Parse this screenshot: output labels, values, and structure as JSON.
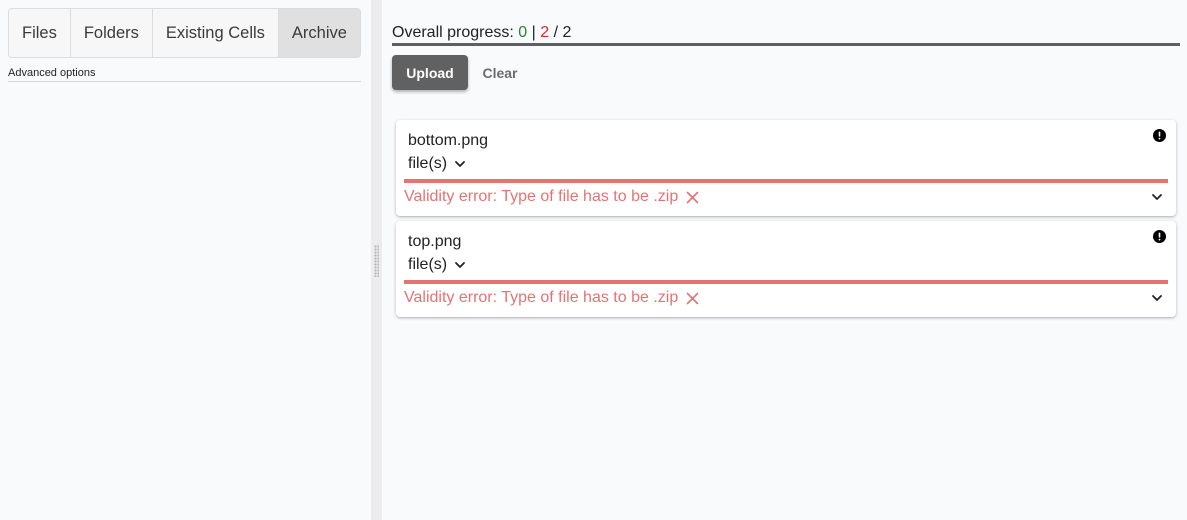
{
  "tabs": [
    {
      "label": "Files"
    },
    {
      "label": "Folders"
    },
    {
      "label": "Existing Cells"
    },
    {
      "label": "Archive",
      "active": true
    }
  ],
  "advanced_options": "Advanced options",
  "progress": {
    "label": "Overall progress:",
    "ok": "0",
    "separator": "|",
    "failed": "2",
    "slash": "/",
    "total": "2"
  },
  "buttons": {
    "upload": "Upload",
    "clear": "Clear"
  },
  "files": [
    {
      "name": "bottom.png",
      "type_label": "file(s)",
      "error": "Validity error: Type of file has to be .zip"
    },
    {
      "name": "top.png",
      "type_label": "file(s)",
      "error": "Validity error: Type of file has to be .zip"
    }
  ],
  "colors": {
    "ok": "#2e7d32",
    "error": "#e57373",
    "upload_button": "#616161"
  }
}
